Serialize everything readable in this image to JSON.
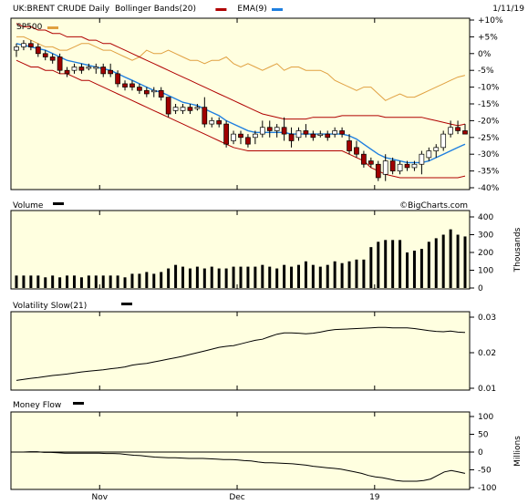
{
  "chart_data": [
    {
      "type": "candlestick",
      "title": "UK:BRENT CRUDE Daily",
      "legend": [
        {
          "label": "Bollinger Bands(20)",
          "color": "#b00000"
        },
        {
          "label": "EMA(9)",
          "color": "#1f7fe0"
        },
        {
          "label": "SP500",
          "color": "#e0a040"
        }
      ],
      "date_label": "1/11/19",
      "watermark": "©BigCharts.com",
      "y_axis": {
        "unit": "percent",
        "ticks": [
          "+10%",
          "+5%",
          "0%",
          "-5%",
          "-10%",
          "-15%",
          "-20%",
          "-25%",
          "-30%",
          "-35%",
          "-40%"
        ],
        "range": [
          -40,
          10
        ]
      },
      "x_ticks": [
        "Nov",
        "Dec",
        "19"
      ],
      "candles": [
        {
          "o": 1,
          "h": 3,
          "l": -1,
          "c": 2
        },
        {
          "o": 2,
          "h": 4,
          "l": 1,
          "c": 3
        },
        {
          "o": 3,
          "h": 4,
          "l": 1,
          "c": 2
        },
        {
          "o": 2,
          "h": 3,
          "l": -1,
          "c": 0
        },
        {
          "o": 0,
          "h": 1,
          "l": -2,
          "c": -1
        },
        {
          "o": -1,
          "h": 0,
          "l": -3,
          "c": -2
        },
        {
          "o": -1,
          "h": 0,
          "l": -6,
          "c": -5
        },
        {
          "o": -5,
          "h": -4,
          "l": -7,
          "c": -6
        },
        {
          "o": -5,
          "h": -3,
          "l": -6,
          "c": -4
        },
        {
          "o": -4,
          "h": -3,
          "l": -6,
          "c": -5
        },
        {
          "o": -4,
          "h": -3,
          "l": -5,
          "c": -4
        },
        {
          "o": -4,
          "h": -3,
          "l": -6,
          "c": -4
        },
        {
          "o": -4,
          "h": -3,
          "l": -7,
          "c": -6
        },
        {
          "o": -5,
          "h": -3,
          "l": -7,
          "c": -6
        },
        {
          "o": -6,
          "h": -5,
          "l": -10,
          "c": -9
        },
        {
          "o": -9,
          "h": -8,
          "l": -11,
          "c": -10
        },
        {
          "o": -9,
          "h": -8,
          "l": -11,
          "c": -10
        },
        {
          "o": -10,
          "h": -9,
          "l": -12,
          "c": -11
        },
        {
          "o": -11,
          "h": -10,
          "l": -13,
          "c": -12
        },
        {
          "o": -11,
          "h": -10,
          "l": -13,
          "c": -11
        },
        {
          "o": -11,
          "h": -10,
          "l": -14,
          "c": -13
        },
        {
          "o": -13,
          "h": -14,
          "l": -19,
          "c": -18
        },
        {
          "o": -17,
          "h": -15,
          "l": -18,
          "c": -16
        },
        {
          "o": -17,
          "h": -15,
          "l": -18,
          "c": -16
        },
        {
          "o": -16,
          "h": -15,
          "l": -18,
          "c": -17
        },
        {
          "o": -16,
          "h": -15,
          "l": -17,
          "c": -16
        },
        {
          "o": -16,
          "h": -13,
          "l": -22,
          "c": -21
        },
        {
          "o": -21,
          "h": -19,
          "l": -22,
          "c": -20
        },
        {
          "o": -20,
          "h": -19,
          "l": -22,
          "c": -21
        },
        {
          "o": -21,
          "h": -20,
          "l": -28,
          "c": -27
        },
        {
          "o": -26,
          "h": -23,
          "l": -27,
          "c": -24
        },
        {
          "o": -24,
          "h": -23,
          "l": -27,
          "c": -25
        },
        {
          "o": -25,
          "h": -24,
          "l": -28,
          "c": -27
        },
        {
          "o": -25,
          "h": -23,
          "l": -27,
          "c": -24
        },
        {
          "o": -24,
          "h": -20,
          "l": -25,
          "c": -22
        },
        {
          "o": -22,
          "h": -20,
          "l": -25,
          "c": -23
        },
        {
          "o": -23,
          "h": -21,
          "l": -25,
          "c": -22
        },
        {
          "o": -22,
          "h": -19,
          "l": -26,
          "c": -24
        },
        {
          "o": -24,
          "h": -22,
          "l": -28,
          "c": -26
        },
        {
          "o": -25,
          "h": -22,
          "l": -26,
          "c": -23
        },
        {
          "o": -23,
          "h": -21,
          "l": -25,
          "c": -24
        },
        {
          "o": -24,
          "h": -23,
          "l": -26,
          "c": -25
        },
        {
          "o": -24,
          "h": -23,
          "l": -25,
          "c": -24
        },
        {
          "o": -24,
          "h": -23,
          "l": -26,
          "c": -25
        },
        {
          "o": -24,
          "h": -22,
          "l": -25,
          "c": -23
        },
        {
          "o": -23,
          "h": -22,
          "l": -25,
          "c": -24
        },
        {
          "o": -26,
          "h": -24,
          "l": -30,
          "c": -29
        },
        {
          "o": -28,
          "h": -26,
          "l": -31,
          "c": -30
        },
        {
          "o": -30,
          "h": -29,
          "l": -34,
          "c": -33
        },
        {
          "o": -32,
          "h": -31,
          "l": -34,
          "c": -33
        },
        {
          "o": -33,
          "h": -32,
          "l": -38,
          "c": -37
        },
        {
          "o": -36,
          "h": -30,
          "l": -38,
          "c": -32
        },
        {
          "o": -32,
          "h": -31,
          "l": -36,
          "c": -35
        },
        {
          "o": -35,
          "h": -32,
          "l": -36,
          "c": -33
        },
        {
          "o": -33,
          "h": -32,
          "l": -35,
          "c": -34
        },
        {
          "o": -34,
          "h": -32,
          "l": -35,
          "c": -33
        },
        {
          "o": -33,
          "h": -29,
          "l": -36,
          "c": -30
        },
        {
          "o": -31,
          "h": -28,
          "l": -32,
          "c": -29
        },
        {
          "o": -29,
          "h": -27,
          "l": -31,
          "c": -28
        },
        {
          "o": -28,
          "h": -23,
          "l": -29,
          "c": -24
        },
        {
          "o": -24,
          "h": -20,
          "l": -25,
          "c": -22
        },
        {
          "o": -22,
          "h": -20,
          "l": -24,
          "c": -23
        },
        {
          "o": -23,
          "h": -21,
          "l": -24,
          "c": -24
        }
      ],
      "bb_upper": [
        9,
        8,
        8,
        7,
        7,
        6,
        6,
        5,
        5,
        5,
        4,
        4,
        3,
        3,
        2,
        1,
        0,
        -1,
        -2,
        -3,
        -4,
        -5,
        -6,
        -7,
        -8,
        -9,
        -10,
        -11,
        -12,
        -13,
        -14,
        -15,
        -16,
        -17,
        -18,
        -18.5,
        -19,
        -19.5,
        -19.5,
        -19.5,
        -19.5,
        -19,
        -19,
        -19,
        -19,
        -18.5,
        -18.5,
        -18.5,
        -18.5,
        -18.5,
        -18.5,
        -19,
        -19,
        -19,
        -19,
        -19,
        -19,
        -19.5,
        -20,
        -20.5,
        -21,
        -21.5,
        -21
      ],
      "bb_lower": [
        -2,
        -3,
        -4,
        -4,
        -5,
        -5,
        -6,
        -6,
        -7,
        -8,
        -8,
        -9,
        -10,
        -11,
        -12,
        -13,
        -14,
        -15,
        -16,
        -17,
        -18,
        -19,
        -20,
        -21,
        -22,
        -23,
        -24,
        -25,
        -26,
        -27,
        -28,
        -28.5,
        -29,
        -29,
        -29,
        -29,
        -29,
        -29,
        -29,
        -29,
        -29,
        -29,
        -29,
        -29,
        -29,
        -29,
        -30,
        -31,
        -32,
        -34,
        -35,
        -36,
        -36.5,
        -37,
        -37,
        -37,
        -37,
        -37,
        -37,
        -37,
        -37,
        -37,
        -36.5
      ],
      "ema9": [
        3,
        2.5,
        2,
        1.5,
        1,
        0,
        -1,
        -2,
        -2.5,
        -3,
        -3.5,
        -4,
        -4.5,
        -5,
        -6,
        -7,
        -8,
        -9,
        -10,
        -11,
        -11.5,
        -12.5,
        -13.5,
        -14.5,
        -15,
        -15.5,
        -16.5,
        -17.5,
        -18.5,
        -20,
        -21,
        -22,
        -23,
        -23.5,
        -23.5,
        -23.5,
        -23.5,
        -23.5,
        -24,
        -24,
        -24,
        -24,
        -24,
        -24,
        -24,
        -24,
        -24.5,
        -25.5,
        -27,
        -28.5,
        -30,
        -31,
        -31.5,
        -32,
        -32.5,
        -32.5,
        -32.5,
        -32,
        -31,
        -30,
        -29,
        -28,
        -27
      ],
      "sp500": [
        5,
        5,
        4,
        3,
        2,
        2,
        1,
        1,
        2,
        3,
        3,
        2,
        1,
        1,
        0,
        -1,
        -2,
        -1,
        1,
        0,
        0,
        1,
        0,
        -1,
        -2,
        -2,
        -3,
        -2,
        -2,
        -1,
        -3,
        -4,
        -3,
        -4,
        -5,
        -4,
        -3,
        -5,
        -4,
        -4,
        -5,
        -5,
        -5,
        -6,
        -8,
        -9,
        -10,
        -11,
        -10,
        -10,
        -12,
        -14,
        -13,
        -12,
        -13,
        -13,
        -12,
        -11,
        -10,
        -9,
        -8,
        -7,
        -6.5
      ],
      "sp500_start": 0
    },
    {
      "type": "bar",
      "title": "Volume",
      "y_axis": {
        "label": "Thousands",
        "ticks": [
          "0",
          "100",
          "200",
          "300",
          "400"
        ],
        "range": [
          0,
          400
        ]
      },
      "values": [
        70,
        70,
        70,
        70,
        60,
        70,
        60,
        70,
        70,
        60,
        70,
        70,
        70,
        70,
        70,
        60,
        80,
        80,
        90,
        80,
        90,
        110,
        130,
        120,
        110,
        120,
        110,
        120,
        110,
        110,
        120,
        120,
        120,
        120,
        130,
        120,
        110,
        130,
        120,
        130,
        150,
        130,
        120,
        130,
        150,
        140,
        150,
        160,
        160,
        230,
        260,
        270,
        270,
        270,
        200,
        210,
        220,
        260,
        280,
        300,
        330,
        300,
        290
      ]
    },
    {
      "type": "line",
      "title": "Volatility Slow(21)",
      "y_axis": {
        "ticks": [
          "0.03",
          "0.02",
          "0.01"
        ],
        "range": [
          0.01,
          0.03
        ]
      },
      "values": [
        0.0122,
        0.0125,
        0.0128,
        0.013,
        0.0133,
        0.0136,
        0.0138,
        0.014,
        0.0143,
        0.0146,
        0.0148,
        0.015,
        0.0152,
        0.0155,
        0.0157,
        0.016,
        0.0165,
        0.0168,
        0.017,
        0.0174,
        0.0178,
        0.0182,
        0.0186,
        0.019,
        0.0195,
        0.02,
        0.0205,
        0.021,
        0.0215,
        0.0218,
        0.022,
        0.0225,
        0.023,
        0.0235,
        0.0238,
        0.0245,
        0.0252,
        0.0256,
        0.0256,
        0.0255,
        0.0253,
        0.0255,
        0.0258,
        0.0262,
        0.0265,
        0.0266,
        0.0267,
        0.0268,
        0.0269,
        0.027,
        0.0271,
        0.0271,
        0.027,
        0.027,
        0.027,
        0.0268,
        0.0265,
        0.0262,
        0.026,
        0.0259,
        0.0261,
        0.0258,
        0.0257
      ]
    },
    {
      "type": "line",
      "title": "Money Flow",
      "y_axis": {
        "label": "Millions",
        "ticks": [
          "100",
          "50",
          "0",
          "-50",
          "-100"
        ],
        "range": [
          -100,
          100
        ]
      },
      "x_ticks": [
        "Nov",
        "Dec",
        "19"
      ],
      "values": [
        0,
        0,
        1,
        1,
        -1,
        -1,
        -2,
        -3,
        -3,
        -3,
        -3,
        -3,
        -3,
        -4,
        -4,
        -5,
        -7,
        -9,
        -10,
        -12,
        -14,
        -15,
        -16,
        -16,
        -17,
        -18,
        -18,
        -18,
        -19,
        -20,
        -21,
        -21,
        -22,
        -24,
        -25,
        -28,
        -30,
        -30,
        -31,
        -32,
        -33,
        -35,
        -37,
        -40,
        -42,
        -44,
        -46,
        -48,
        -52,
        -56,
        -60,
        -66,
        -70,
        -72,
        -76,
        -80,
        -82,
        -82,
        -82,
        -80,
        -76,
        -66,
        -56,
        -52,
        -56,
        -60
      ]
    }
  ]
}
